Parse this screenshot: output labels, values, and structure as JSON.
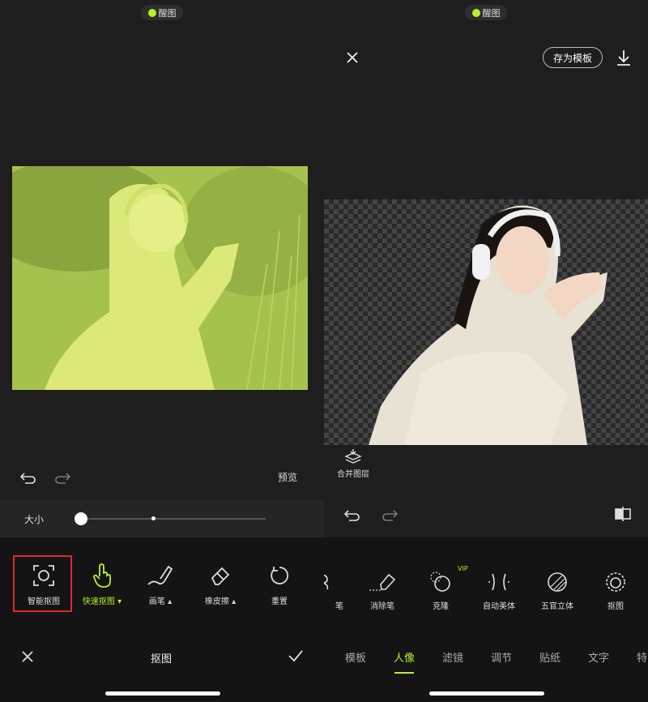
{
  "left": {
    "app_name": "醒图",
    "preview_label": "预览",
    "size_label": "大小",
    "size_value": 0.0,
    "tools": [
      {
        "label": "智能抠图",
        "icon": "smart-cutout-icon"
      },
      {
        "label": "快速抠图 ▾",
        "icon": "hand-tap-icon"
      },
      {
        "label": "画笔 ▴",
        "icon": "brush-icon"
      },
      {
        "label": "橡皮擦 ▴",
        "icon": "eraser-icon"
      },
      {
        "label": "重置",
        "icon": "reset-icon"
      }
    ],
    "bottom_title": "抠图",
    "accent": "#b8f02c",
    "highlight": "#e0282a"
  },
  "right": {
    "app_name": "醒图",
    "save_template_label": "存为模板",
    "merge_label": "合并图层",
    "tools": [
      {
        "label": "笔",
        "icon": "brush-partial-icon"
      },
      {
        "label": "消除笔",
        "icon": "eraser-pen-icon"
      },
      {
        "label": "克隆",
        "icon": "clone-icon"
      },
      {
        "label": "自动美体",
        "icon": "auto-body-icon"
      },
      {
        "label": "五官立体",
        "icon": "face-3d-icon"
      },
      {
        "label": "抠图",
        "icon": "cutout-icon"
      }
    ],
    "vip_badge": "VIP",
    "tabs": [
      "模板",
      "人像",
      "滤镜",
      "调节",
      "贴纸",
      "文字",
      "特"
    ],
    "active_tab": "人像"
  }
}
